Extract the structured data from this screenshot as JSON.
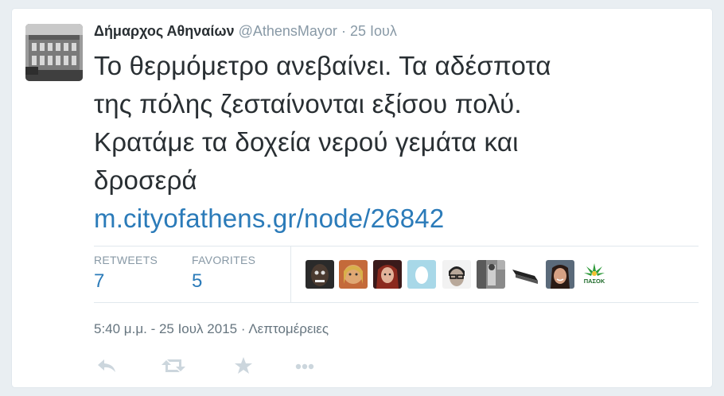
{
  "tweet": {
    "name": "Δήμαρχος Αθηναίων",
    "handle": "@AthensMayor",
    "separator": "·",
    "date": "25 Ιουλ",
    "text_lines": [
      "Το θερμόμετρο ανεβαίνει. Τα αδέσποτα",
      "της πόλης ζεσταίνονται εξίσου πολύ.",
      "Κρατάμε τα δοχεία νερού γεμάτα και",
      "δροσερά"
    ],
    "link": "m.cityofathens.gr/node/26842"
  },
  "stats": {
    "retweets_label": "RETWEETS",
    "retweets_count": "7",
    "favorites_label": "FAVORITES",
    "favorites_count": "5"
  },
  "favoriters": [
    {
      "icon": "avatar-dark-face"
    },
    {
      "icon": "avatar-blonde-woman"
    },
    {
      "icon": "avatar-red-haired-woman"
    },
    {
      "icon": "avatar-default-egg"
    },
    {
      "icon": "avatar-man-glasses"
    },
    {
      "icon": "avatar-grey-photo"
    },
    {
      "icon": "avatar-black-object"
    },
    {
      "icon": "avatar-smiling-woman"
    },
    {
      "icon": "avatar-paok-logo",
      "logo_text": "ΠΑΣΟΚ"
    }
  ],
  "meta": {
    "timestamp": "5:40 μ.μ. - 25 Ιουλ 2015",
    "separator": "·",
    "details_link": "Λεπτομέρειες"
  },
  "actions": [
    {
      "icon": "reply-icon"
    },
    {
      "icon": "retweet-icon"
    },
    {
      "icon": "favorite-star-icon"
    },
    {
      "icon": "more-dots-icon"
    }
  ],
  "colors": {
    "link": "#2b7bb9",
    "muted": "#8899a6",
    "text": "#292f33",
    "action": "#ccd6dd"
  }
}
